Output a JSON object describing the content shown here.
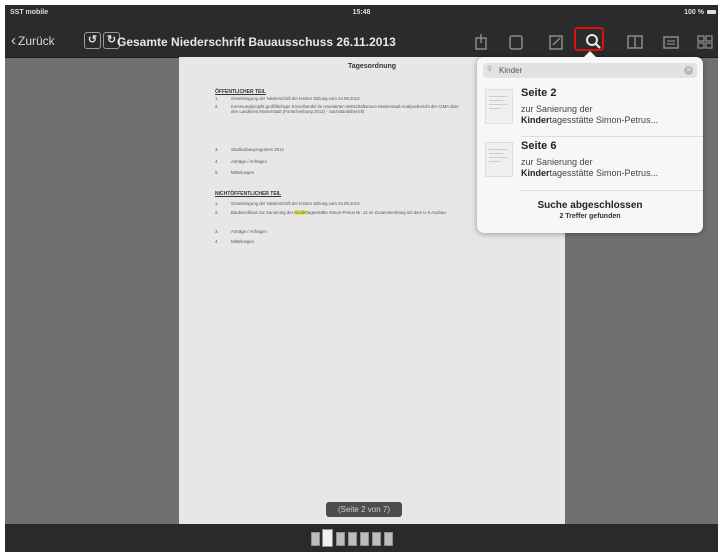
{
  "status_bar": {
    "carrier": "SST mobile",
    "time": "15:48",
    "battery": "100 %"
  },
  "nav": {
    "back_label": "Zurück",
    "doc_title": "Gesamte Niederschrift Bauausschuss 26.11.2013"
  },
  "document": {
    "heading": "Tagesordnung",
    "public_section": "ÖFFENTLICHER TEIL",
    "public_items": [
      {
        "n": "1.",
        "t": "Genehmigung der Niederschrift der letzten Sitzung vom 24.09.2013"
      },
      {
        "n": "2.",
        "t": "Kommunalprojekt großflächiger Einzelhandel im erweiterten Wirtschaftsraum Mosterstadt Analysebericht der CIMA über den Landkreis Mosterstadt (Fortschreibung 2012) - Sachstandsbericht"
      },
      {
        "n": "3.",
        "t": "Straßenbauprogramm 2014"
      },
      {
        "n": "4.",
        "t": "Anträge / Anfragen"
      },
      {
        "n": "5.",
        "t": "Mitteilungen"
      }
    ],
    "nonpublic_section": "NICHTÖFFENTLICHER TEIL",
    "nonpublic_items": [
      {
        "n": "1.",
        "t": "Genehmigung der Niederschrift der letzten Sitzung vom 24.09.2013"
      },
      {
        "n": "2.",
        "pre": "Baubeschluss zur Sanierung der ",
        "hl": "Kinder",
        "post": "tagesstätte Simon-Petrus Nr. 12 im Zusammenhang mit dem U-3 Ausbau"
      },
      {
        "n": "3.",
        "t": "Anträge / Anfragen"
      },
      {
        "n": "4.",
        "t": "Mitteilungen"
      }
    ],
    "page_indicator": "(Seite 2 von 7)"
  },
  "search": {
    "query": "Kinder",
    "results": [
      {
        "page": "Seite 2",
        "line1": "zur Sanierung der",
        "match": "Kinder",
        "rest": "tagesstätte Simon-Petrus..."
      },
      {
        "page": "Seite 6",
        "line1": "zur Sanierung der",
        "match": "Kinder",
        "rest": "tagesstätte Simon-Petrus..."
      }
    ],
    "status_title": "Suche abgeschlossen",
    "status_sub": "2 Treffer gefunden"
  },
  "thumbnails": {
    "count": 7,
    "active_index": 1
  },
  "colors": {
    "highlight_box": "#e01010",
    "match_highlight": "#e6e95a",
    "toolbar_bg": "#2b2b2b"
  }
}
